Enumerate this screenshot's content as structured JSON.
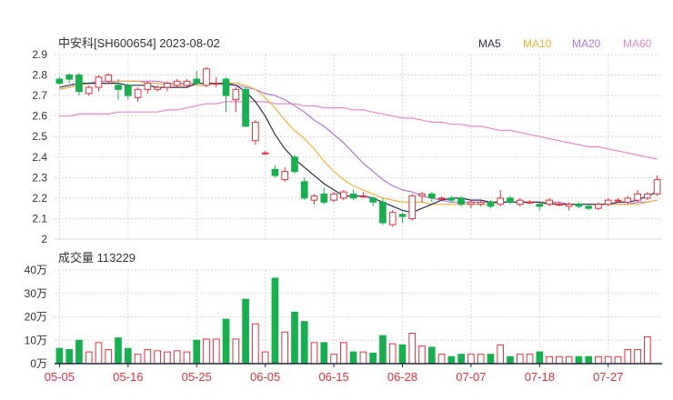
{
  "colors": {
    "up": "#e8303c",
    "down": "#16b14f",
    "grid": "#d8d8d8",
    "axis": "#1f2a44",
    "text": "#333333",
    "date": "#e8303c",
    "ma5": "#2b2d57",
    "ma10": "#f0b33a",
    "ma20": "#b676dc",
    "ma60": "#e78ac9"
  },
  "chart_data": [
    {
      "type": "candlestick",
      "title": "中安科[SH600654] 2023-08-02",
      "legend": [
        "MA5",
        "MA10",
        "MA20",
        "MA60"
      ],
      "legend_position": "top-right",
      "ylim": [
        2,
        2.9
      ],
      "yticks": [
        "2.9",
        "2.8",
        "2.7",
        "2.6",
        "2.5",
        "2.4",
        "2.3",
        "2.2",
        "2.1",
        "2"
      ],
      "xticks": [
        "05-05",
        "05-16",
        "05-25",
        "06-05",
        "06-15",
        "06-28",
        "07-07",
        "07-18",
        "07-27"
      ],
      "xtick_index": [
        0,
        7,
        14,
        21,
        28,
        35,
        42,
        49,
        56
      ],
      "grid": true,
      "ohlc": [
        [
          2.78,
          2.76,
          2.79,
          2.75
        ],
        [
          2.8,
          2.78,
          2.81,
          2.76
        ],
        [
          2.8,
          2.72,
          2.81,
          2.7
        ],
        [
          2.71,
          2.74,
          2.75,
          2.7
        ],
        [
          2.74,
          2.79,
          2.8,
          2.72
        ],
        [
          2.77,
          2.8,
          2.81,
          2.76
        ],
        [
          2.75,
          2.73,
          2.78,
          2.68
        ],
        [
          2.75,
          2.7,
          2.76,
          2.68
        ],
        [
          2.69,
          2.73,
          2.74,
          2.67
        ],
        [
          2.73,
          2.76,
          2.77,
          2.71
        ],
        [
          2.73,
          2.74,
          2.75,
          2.72
        ],
        [
          2.74,
          2.76,
          2.77,
          2.72
        ],
        [
          2.75,
          2.77,
          2.78,
          2.74
        ],
        [
          2.75,
          2.77,
          2.78,
          2.74
        ],
        [
          2.78,
          2.76,
          2.82,
          2.75
        ],
        [
          2.75,
          2.83,
          2.84,
          2.74
        ],
        [
          2.76,
          2.76,
          2.79,
          2.74
        ],
        [
          2.78,
          2.7,
          2.79,
          2.62
        ],
        [
          2.68,
          2.73,
          2.74,
          2.62
        ],
        [
          2.73,
          2.55,
          2.74,
          2.55
        ],
        [
          2.48,
          2.57,
          2.58,
          2.46
        ],
        [
          2.42,
          2.42,
          2.43,
          2.41
        ],
        [
          2.34,
          2.31,
          2.36,
          2.3
        ],
        [
          2.29,
          2.33,
          2.35,
          2.28
        ],
        [
          2.4,
          2.33,
          2.41,
          2.32
        ],
        [
          2.28,
          2.2,
          2.3,
          2.19
        ],
        [
          2.19,
          2.21,
          2.22,
          2.17
        ],
        [
          2.22,
          2.18,
          2.25,
          2.17
        ],
        [
          2.19,
          2.22,
          2.23,
          2.18
        ],
        [
          2.2,
          2.23,
          2.24,
          2.19
        ],
        [
          2.22,
          2.2,
          2.24,
          2.19
        ],
        [
          2.21,
          2.21,
          2.23,
          2.2
        ],
        [
          2.2,
          2.18,
          2.21,
          2.16
        ],
        [
          2.18,
          2.08,
          2.2,
          2.07
        ],
        [
          2.07,
          2.13,
          2.14,
          2.06
        ],
        [
          2.12,
          2.11,
          2.13,
          2.08
        ],
        [
          2.1,
          2.21,
          2.22,
          2.09
        ],
        [
          2.21,
          2.22,
          2.23,
          2.18
        ],
        [
          2.22,
          2.2,
          2.23,
          2.18
        ],
        [
          2.2,
          2.2,
          2.21,
          2.19
        ],
        [
          2.2,
          2.19,
          2.21,
          2.18
        ],
        [
          2.2,
          2.17,
          2.21,
          2.16
        ],
        [
          2.17,
          2.18,
          2.19,
          2.15
        ],
        [
          2.17,
          2.18,
          2.19,
          2.16
        ],
        [
          2.18,
          2.16,
          2.19,
          2.15
        ],
        [
          2.17,
          2.2,
          2.24,
          2.16
        ],
        [
          2.2,
          2.18,
          2.21,
          2.17
        ],
        [
          2.17,
          2.19,
          2.2,
          2.16
        ],
        [
          2.18,
          2.18,
          2.19,
          2.17
        ],
        [
          2.17,
          2.16,
          2.18,
          2.14
        ],
        [
          2.17,
          2.19,
          2.2,
          2.16
        ],
        [
          2.17,
          2.17,
          2.18,
          2.16
        ],
        [
          2.16,
          2.17,
          2.18,
          2.14
        ],
        [
          2.17,
          2.16,
          2.18,
          2.15
        ],
        [
          2.16,
          2.15,
          2.17,
          2.14
        ],
        [
          2.15,
          2.17,
          2.18,
          2.14
        ],
        [
          2.17,
          2.19,
          2.2,
          2.16
        ],
        [
          2.19,
          2.19,
          2.2,
          2.18
        ],
        [
          2.18,
          2.2,
          2.21,
          2.17
        ],
        [
          2.19,
          2.22,
          2.24,
          2.18
        ],
        [
          2.2,
          2.22,
          2.23,
          2.19
        ],
        [
          2.22,
          2.29,
          2.31,
          2.21
        ]
      ],
      "ma5": [
        2.74,
        2.75,
        2.76,
        2.76,
        2.76,
        2.76,
        2.76,
        2.75,
        2.75,
        2.75,
        2.74,
        2.74,
        2.74,
        2.74,
        2.76,
        2.76,
        2.76,
        2.76,
        2.75,
        2.72,
        2.67,
        2.6,
        2.51,
        2.44,
        2.39,
        2.35,
        2.31,
        2.27,
        2.24,
        2.21,
        2.21,
        2.21,
        2.2,
        2.18,
        2.16,
        2.14,
        2.13,
        2.15,
        2.17,
        2.19,
        2.2,
        2.2,
        2.19,
        2.19,
        2.18,
        2.18,
        2.18,
        2.18,
        2.18,
        2.18,
        2.17,
        2.17,
        2.17,
        2.17,
        2.17,
        2.17,
        2.17,
        2.18,
        2.18,
        2.19,
        2.21,
        2.23
      ],
      "ma10": [
        2.73,
        2.74,
        2.75,
        2.76,
        2.76,
        2.76,
        2.77,
        2.77,
        2.77,
        2.76,
        2.76,
        2.75,
        2.75,
        2.75,
        2.75,
        2.75,
        2.76,
        2.76,
        2.76,
        2.75,
        2.73,
        2.69,
        2.64,
        2.58,
        2.53,
        2.49,
        2.44,
        2.38,
        2.33,
        2.29,
        2.26,
        2.24,
        2.22,
        2.2,
        2.19,
        2.18,
        2.18,
        2.18,
        2.17,
        2.17,
        2.17,
        2.17,
        2.17,
        2.17,
        2.17,
        2.18,
        2.18,
        2.18,
        2.18,
        2.18,
        2.18,
        2.17,
        2.17,
        2.17,
        2.17,
        2.17,
        2.17,
        2.17,
        2.17,
        2.17,
        2.18,
        2.19
      ],
      "ma20": [
        2.73,
        2.74,
        2.75,
        2.76,
        2.77,
        2.77,
        2.77,
        2.77,
        2.77,
        2.77,
        2.77,
        2.76,
        2.76,
        2.76,
        2.76,
        2.76,
        2.76,
        2.75,
        2.75,
        2.74,
        2.73,
        2.71,
        2.7,
        2.68,
        2.65,
        2.62,
        2.58,
        2.55,
        2.51,
        2.47,
        2.42,
        2.37,
        2.33,
        2.29,
        2.26,
        2.24,
        2.23,
        2.21,
        2.2,
        2.19,
        2.18,
        2.18,
        2.18,
        2.18,
        2.18,
        2.18,
        2.18,
        2.18,
        2.18,
        2.18,
        2.18,
        2.18,
        2.17,
        2.17,
        2.17,
        2.17,
        2.17,
        2.17,
        2.17,
        2.18,
        2.18,
        2.19
      ],
      "ma60": [
        2.6,
        2.6,
        2.61,
        2.61,
        2.61,
        2.61,
        2.62,
        2.62,
        2.62,
        2.62,
        2.62,
        2.63,
        2.63,
        2.64,
        2.65,
        2.66,
        2.66,
        2.67,
        2.67,
        2.67,
        2.67,
        2.67,
        2.66,
        2.66,
        2.66,
        2.65,
        2.65,
        2.64,
        2.64,
        2.64,
        2.63,
        2.63,
        2.62,
        2.61,
        2.6,
        2.59,
        2.59,
        2.58,
        2.57,
        2.57,
        2.56,
        2.56,
        2.55,
        2.55,
        2.54,
        2.53,
        2.53,
        2.52,
        2.51,
        2.5,
        2.49,
        2.48,
        2.47,
        2.46,
        2.45,
        2.45,
        2.44,
        2.43,
        2.42,
        2.41,
        2.4,
        2.39
      ]
    },
    {
      "type": "bar",
      "title": "成交量 113229",
      "ylim": [
        0,
        40
      ],
      "yticks": [
        "40万",
        "30万",
        "20万",
        "10万",
        "0万"
      ],
      "values": [
        6.5,
        6,
        10,
        5,
        9,
        6,
        11,
        6.5,
        4,
        6,
        5.5,
        5,
        5.5,
        5,
        10,
        10.5,
        10.5,
        19,
        10.5,
        27.5,
        17,
        5,
        36.5,
        13.5,
        22,
        18,
        9,
        9,
        4,
        9,
        5,
        5,
        4.5,
        12,
        8.5,
        8,
        13,
        7.5,
        7,
        4,
        3,
        4,
        4,
        4,
        4,
        8,
        3,
        4,
        4,
        5,
        3,
        3,
        3,
        3,
        3,
        3,
        3,
        3,
        6,
        6,
        11.5
      ]
    }
  ]
}
